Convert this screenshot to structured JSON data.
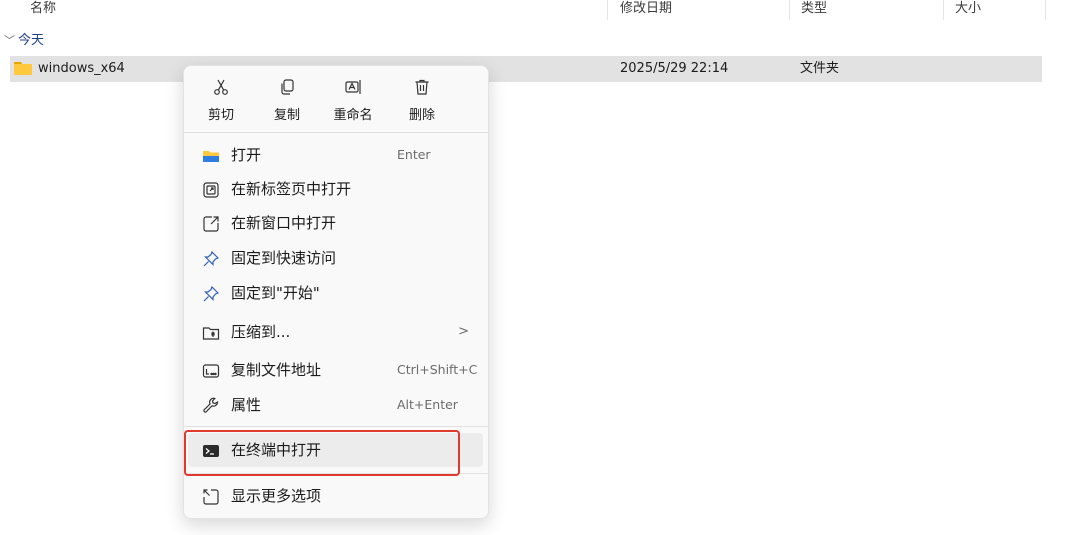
{
  "columns": {
    "name": "名称",
    "modified": "修改日期",
    "type": "类型",
    "size": "大小"
  },
  "group": {
    "label": "今天"
  },
  "file": {
    "name": "windows_x64",
    "modified": "2025/5/29 22:14",
    "type": "文件夹",
    "icon": "folder-icon"
  },
  "context_menu": {
    "quick_actions": [
      {
        "label": "剪切",
        "icon": "scissors-icon"
      },
      {
        "label": "复制",
        "icon": "copy-icon"
      },
      {
        "label": "重命名",
        "icon": "rename-icon"
      },
      {
        "label": "删除",
        "icon": "trash-icon"
      }
    ],
    "items": [
      {
        "label": "打开",
        "shortcut": "Enter",
        "icon": "folder-open-icon"
      },
      {
        "label": "在新标签页中打开",
        "shortcut": "",
        "icon": "new-tab-icon"
      },
      {
        "label": "在新窗口中打开",
        "shortcut": "",
        "icon": "new-window-icon"
      },
      {
        "label": "固定到快速访问",
        "shortcut": "",
        "icon": "pin-icon"
      },
      {
        "label": "固定到\"开始\"",
        "shortcut": "",
        "icon": "pin-icon"
      },
      {
        "label": "压缩到...",
        "shortcut": "",
        "icon": "zip-folder-icon",
        "submenu_arrow": ">"
      },
      {
        "label": "复制文件地址",
        "shortcut": "Ctrl+Shift+C",
        "icon": "copy-path-icon"
      },
      {
        "label": "属性",
        "shortcut": "Alt+Enter",
        "icon": "wrench-icon"
      },
      {
        "label": "在终端中打开",
        "shortcut": "",
        "icon": "terminal-icon",
        "highlighted": true
      },
      {
        "label": "显示更多选项",
        "shortcut": "",
        "icon": "more-options-icon"
      }
    ]
  },
  "colors": {
    "selection": "#e2e2e2",
    "highlight_border": "#e03a2f",
    "folder": "#ffc83d",
    "group_label": "#1f3f8a"
  }
}
